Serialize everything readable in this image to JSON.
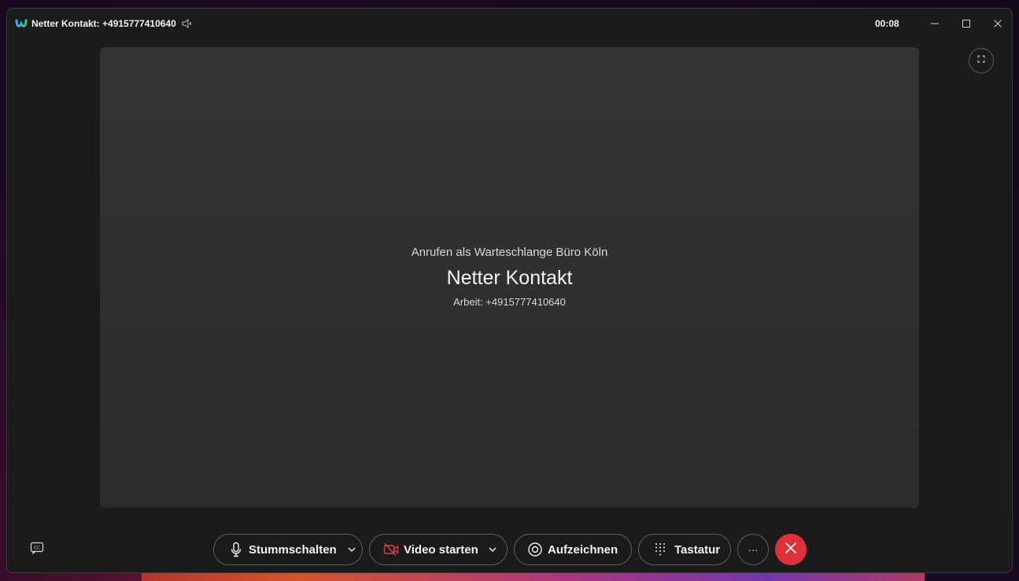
{
  "window": {
    "title": "Netter Kontakt: +4915777410640",
    "timer": "00:08"
  },
  "call": {
    "calling_as": "Anrufen als Warteschlange Büro Köln",
    "name": "Netter Kontakt",
    "number": "Arbeit: +4915777410640"
  },
  "controls": {
    "mute_label": "Stummschalten",
    "video_label": "Video starten",
    "record_label": "Aufzeichnen",
    "keypad_label": "Tastatur",
    "more_label": "···"
  },
  "icons": {
    "app": "webex-logo-icon",
    "speaker": "speaker-icon",
    "fullscreen": "fullscreen-icon",
    "cc": "closed-captions-icon",
    "mic": "microphone-icon",
    "video": "video-off-icon",
    "record": "record-icon",
    "keypad": "dialpad-icon",
    "hangup": "end-call-icon"
  },
  "colors": {
    "hangup": "#e0303a",
    "video_off": "#e0404a",
    "background": "#1b1b1b"
  }
}
